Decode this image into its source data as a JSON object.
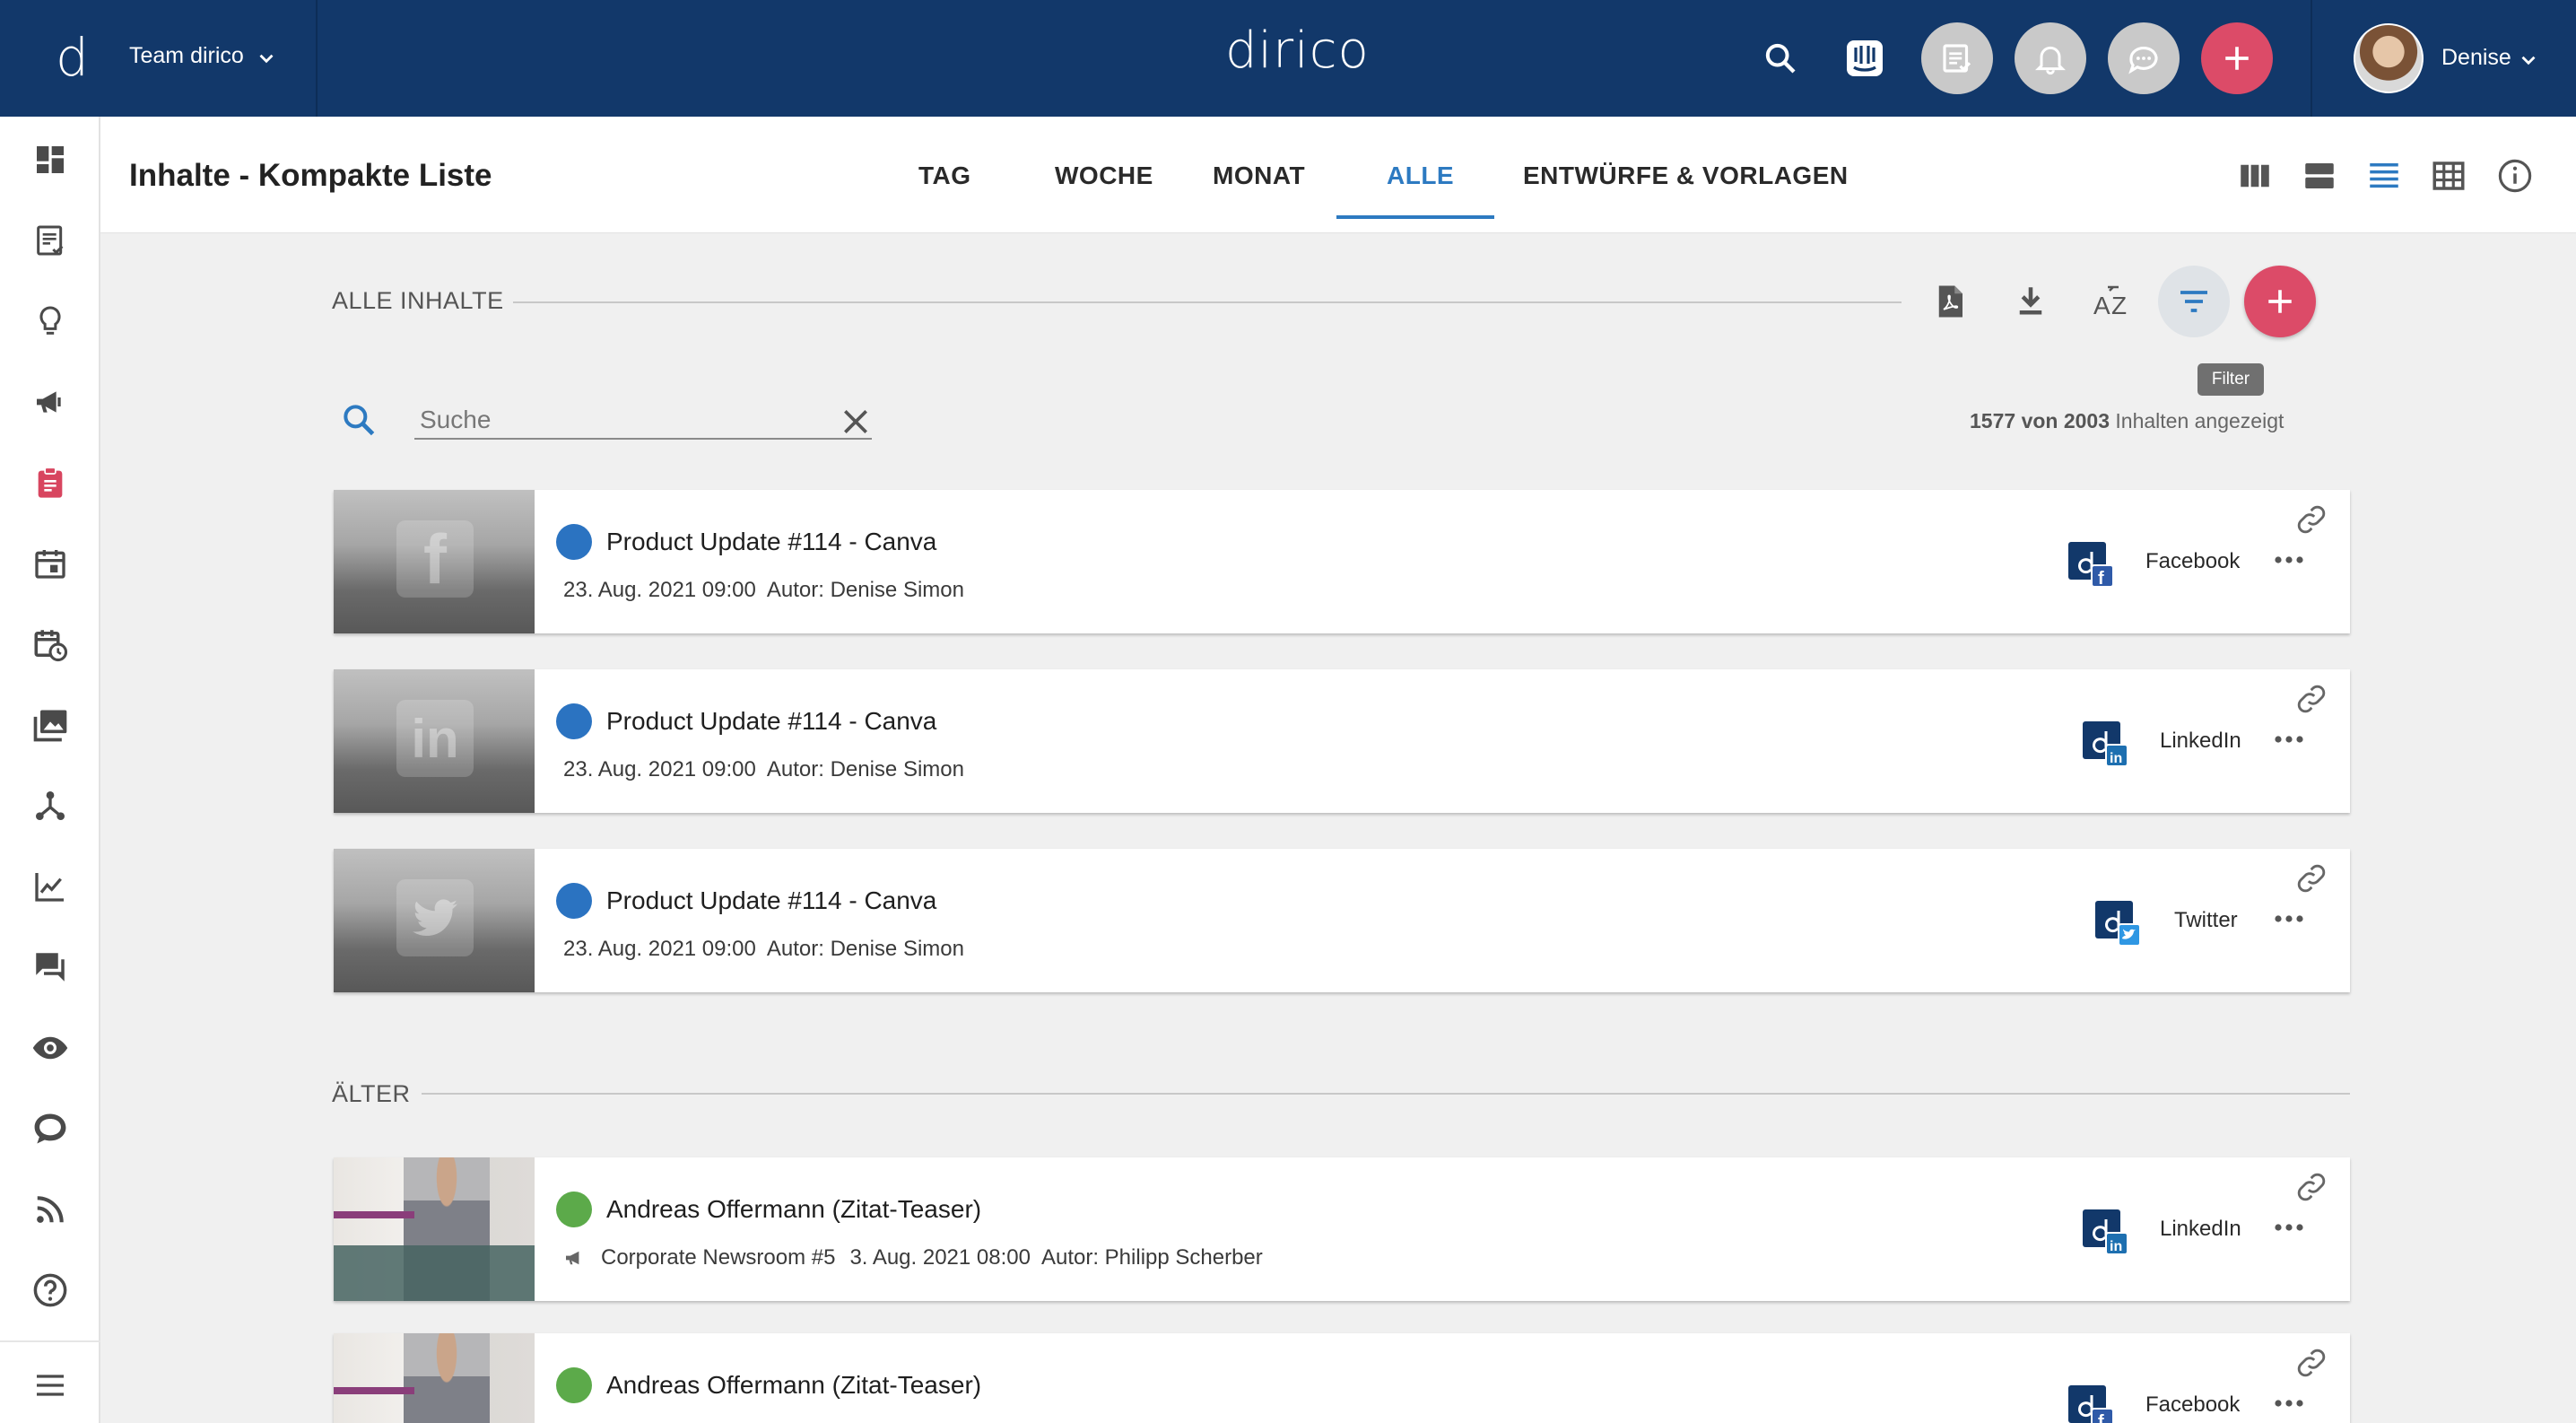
{
  "app": {
    "team_name": "Team dirico",
    "brand": "dirico",
    "user_name": "Denise"
  },
  "colors": {
    "topbar": "#12386a",
    "accent_blue": "#2d7ac1",
    "accent_red": "#dc4b68",
    "status_blue": "#2b73c1",
    "status_green": "#5caa4a"
  },
  "sidebar": {
    "items": [
      {
        "icon": "dashboard-icon"
      },
      {
        "icon": "content-list-icon"
      },
      {
        "icon": "idea-lightbulb-icon"
      },
      {
        "icon": "campaign-megaphone-icon"
      },
      {
        "icon": "clipboard-icon",
        "active": true
      },
      {
        "icon": "calendar-icon"
      },
      {
        "icon": "schedule-calendar-icon"
      },
      {
        "icon": "media-library-icon"
      },
      {
        "icon": "network-hierarchy-icon"
      },
      {
        "icon": "analytics-chart-icon"
      },
      {
        "icon": "comments-icon"
      },
      {
        "icon": "monitoring-eye-icon"
      },
      {
        "icon": "chat-bubble-icon"
      },
      {
        "icon": "rss-feed-icon"
      },
      {
        "icon": "help-icon"
      },
      {
        "icon": "menu-icon"
      }
    ]
  },
  "header": {
    "title": "Inhalte - Kompakte Liste",
    "tabs": [
      {
        "label": "TAG"
      },
      {
        "label": "WOCHE"
      },
      {
        "label": "MONAT"
      },
      {
        "label": "ALLE",
        "active": true
      },
      {
        "label": "ENTWÜRFE & VORLAGEN"
      }
    ]
  },
  "toolbar": {
    "section_all": "ALLE INHALTE",
    "section_older": "ÄLTER",
    "filter_tooltip": "Filter"
  },
  "search": {
    "placeholder": "Suche",
    "value": ""
  },
  "count": {
    "shown": "1577",
    "separator": "von",
    "total": "2003",
    "suffix": "Inhalten angezeigt"
  },
  "items": [
    {
      "title": "Product Update #114 - Canva",
      "date": "23. Aug. 2021 09:00",
      "author": "Autor: Denise Simon",
      "channel": "Facebook",
      "status": "blue"
    },
    {
      "title": "Product Update #114 - Canva",
      "date": "23. Aug. 2021 09:00",
      "author": "Autor: Denise Simon",
      "channel": "LinkedIn",
      "status": "blue"
    },
    {
      "title": "Product Update #114 - Canva",
      "date": "23. Aug. 2021 09:00",
      "author": "Autor: Denise Simon",
      "channel": "Twitter",
      "status": "blue"
    }
  ],
  "older_items": [
    {
      "title": "Andreas Offermann (Zitat-Teaser)",
      "campaign": "Corporate Newsroom #5",
      "date": "3. Aug. 2021 08:00",
      "author": "Autor: Philipp Scherber",
      "channel": "LinkedIn",
      "status": "green"
    },
    {
      "title": "Andreas Offermann (Zitat-Teaser)",
      "channel": "Facebook",
      "status": "green"
    }
  ]
}
